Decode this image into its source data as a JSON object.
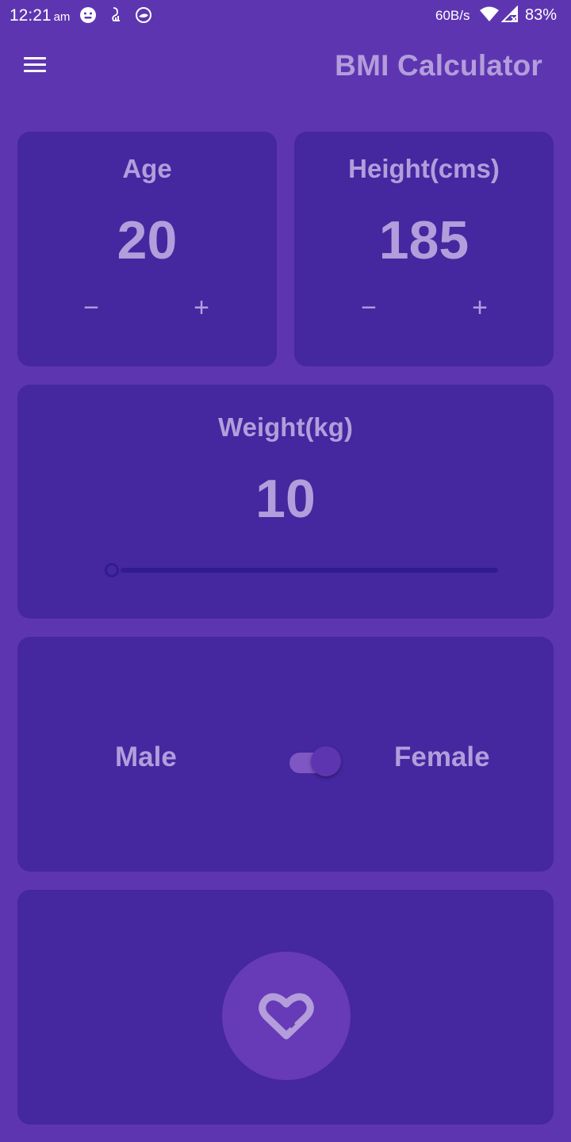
{
  "status_bar": {
    "time": "12:21",
    "ampm": "am",
    "network_speed": "60B/s",
    "battery": "83%",
    "icons": [
      "face-icon",
      "data-usage-icon",
      "vpn-icon",
      "wifi-icon",
      "signal-icon"
    ]
  },
  "app_bar": {
    "title": "BMI Calculator",
    "menu_icon": "hamburger-menu-icon"
  },
  "age_card": {
    "label": "Age",
    "value": "20",
    "decrement": "−",
    "increment": "+"
  },
  "height_card": {
    "label": "Height(cms)",
    "value": "185",
    "decrement": "−",
    "increment": "+"
  },
  "weight_card": {
    "label": "Weight(kg)",
    "value": "10",
    "slider_level": 0.0
  },
  "gender_card": {
    "male_label": "Male",
    "female_label": "Female",
    "toggle_on": true
  },
  "calculate_card": {
    "button_icon": "heart-outline-icon"
  },
  "colors": {
    "background": "#5e35b1",
    "card": "#4527a0",
    "text_accent": "#b39ddb",
    "button": "#673ab7"
  }
}
